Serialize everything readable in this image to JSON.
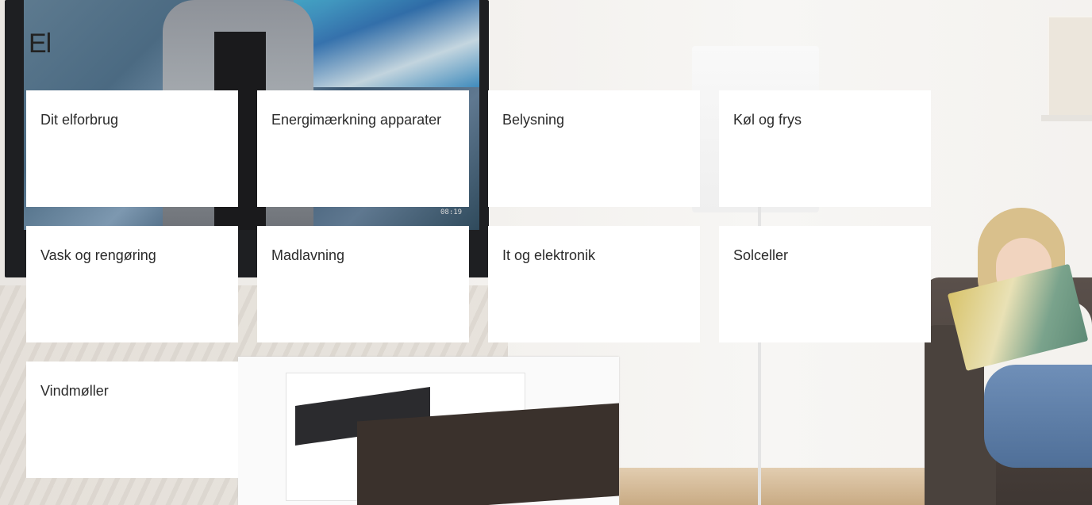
{
  "page": {
    "title": "El"
  },
  "tv": {
    "clock": "08:19"
  },
  "tiles": [
    {
      "label": "Dit elforbrug"
    },
    {
      "label": "Energimærkning apparater"
    },
    {
      "label": "Belysning"
    },
    {
      "label": "Køl og frys"
    },
    {
      "label": "Vask og rengøring"
    },
    {
      "label": "Madlavning"
    },
    {
      "label": "It og elektronik"
    },
    {
      "label": "Solceller"
    },
    {
      "label": "Vindmøller"
    }
  ]
}
